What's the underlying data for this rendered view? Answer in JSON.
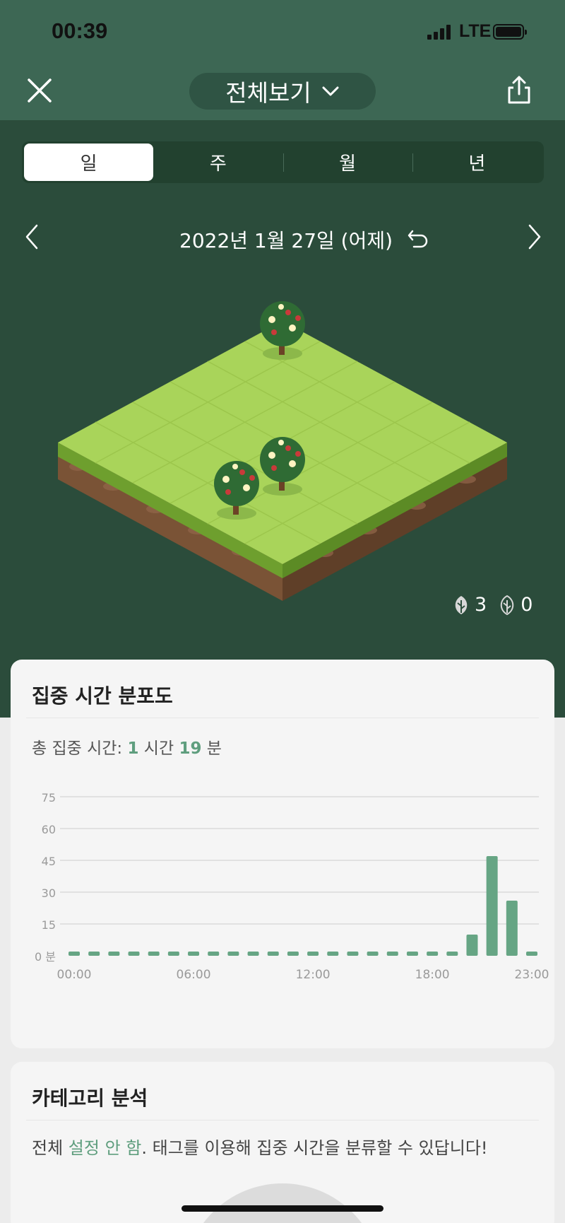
{
  "status": {
    "time": "00:39",
    "network": "LTE"
  },
  "header": {
    "title": "전체보기",
    "icons": [
      "close-icon",
      "chevron-down-icon",
      "share-icon"
    ]
  },
  "tabs": [
    {
      "label": "일",
      "active": true
    },
    {
      "label": "주",
      "active": false
    },
    {
      "label": "월",
      "active": false
    },
    {
      "label": "년",
      "active": false
    }
  ],
  "date_nav": {
    "date": "2022년 1월 27일 (어제)",
    "icons": [
      "chevron-left-icon",
      "undo-icon",
      "chevron-right-icon"
    ]
  },
  "forest": {
    "healthy_count": "3",
    "withered_count": "0",
    "trees": 3
  },
  "focus_card": {
    "title": "집중 시간 분포도",
    "total_prefix": "총 집중 시간: ",
    "hours": "1",
    "hours_unit": " 시간 ",
    "minutes": "19",
    "minutes_unit": " 분"
  },
  "chart_data": {
    "type": "bar",
    "title": "집중 시간 분포도",
    "xlabel": "",
    "ylabel": "",
    "yticks": [
      "0 분",
      "15",
      "30",
      "45",
      "60",
      "75"
    ],
    "ylim": [
      0,
      75
    ],
    "xticks": [
      "00:00",
      "06:00",
      "12:00",
      "18:00",
      "23:00"
    ],
    "categories": [
      "0",
      "1",
      "2",
      "3",
      "4",
      "5",
      "6",
      "7",
      "8",
      "9",
      "10",
      "11",
      "12",
      "13",
      "14",
      "15",
      "16",
      "17",
      "18",
      "19",
      "20",
      "21",
      "22",
      "23"
    ],
    "values": [
      0,
      0,
      0,
      0,
      0,
      0,
      0,
      0,
      0,
      0,
      0,
      0,
      0,
      0,
      0,
      0,
      0,
      0,
      0,
      0,
      10,
      47,
      26,
      0
    ],
    "bar_color": "#66a584",
    "grid": true
  },
  "category_card": {
    "title": "카테고리 분석",
    "desc_prefix": "전체 ",
    "desc_link": "설정 안 함",
    "desc_suffix": ". 태그를 이용해 집중 시간을 분류할 수 있답니다!"
  },
  "colors": {
    "header": "#3d6754",
    "forest_bg": "#2b4c3b",
    "accent": "#5f9e7e"
  }
}
